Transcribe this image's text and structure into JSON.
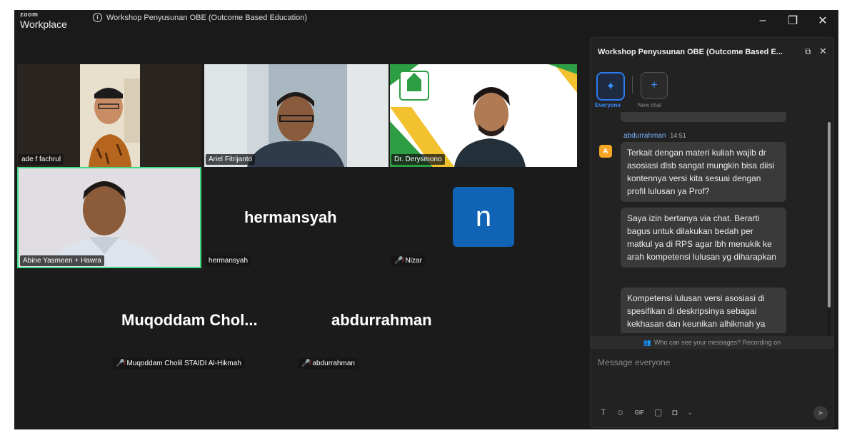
{
  "window": {
    "brand_small": "zoom",
    "brand_name": "Workplace",
    "meeting_title": "Workshop Penyusunan OBE (Outcome Based Education)",
    "controls": {
      "minimize": "–",
      "restore": "❐",
      "close": "✕"
    }
  },
  "participants": [
    {
      "name": "ade f fachrul",
      "video": true
    },
    {
      "name": "Ariel Fitrijanto",
      "video": true
    },
    {
      "name": "Dr. Derysmono",
      "video": true
    },
    {
      "name": "Abine Yasmeen + Hawra",
      "video": true,
      "active_speaker": true
    },
    {
      "name": "hermansyah",
      "display_name": "hermansyah",
      "video": false
    },
    {
      "name": "Nizar",
      "avatar_letter": "n",
      "video": false,
      "muted": true
    },
    {
      "name": "Muqoddam Cholil STAIDI Al-Hikmah",
      "display_name": "Muqoddam  Chol...",
      "video": false,
      "muted": true
    },
    {
      "name": "abdurrahman",
      "display_name": "abdurrahman",
      "video": false,
      "muted": true
    }
  ],
  "chat": {
    "title": "Workshop Penyusunan OBE (Outcome Based E...",
    "channels": [
      {
        "label": "Everyone",
        "icon": "people-icon",
        "active": true
      },
      {
        "label": "New chat",
        "icon": "plus-icon",
        "active": false
      }
    ],
    "messages": [
      {
        "sender": "abdurrahman",
        "time": "14:51",
        "avatar": "A",
        "texts": [
          "Terkait dengan materi kuliah wajib dr asosiasi dlsb sangat mungkin bisa diisi kontennya versi kita sesuai dengan profil lulusan ya Prof?",
          "Saya izin bertanya via chat. Berarti bagus untuk dilakukan bedah per matkul ya di RPS agar lbh menukik ke arah kompetensi lulusan yg diharapkan",
          "Kompetensi lulusan versi asosiasi di spesifikan di deskripsinya sebagai kekhasan dan keunikan alhikmah ya"
        ]
      }
    ],
    "privacy_note": "Who can see your messages? Recording on",
    "input_placeholder": "Message everyone",
    "toolbar": [
      "T",
      "☺",
      "GIF",
      "▢",
      "◘",
      "⌄"
    ]
  },
  "colors": {
    "accent": "#2b7cf0",
    "avatar_blue": "#1164b5",
    "mute_red": "#e0383e",
    "speaker_border": "#3ddc84"
  }
}
